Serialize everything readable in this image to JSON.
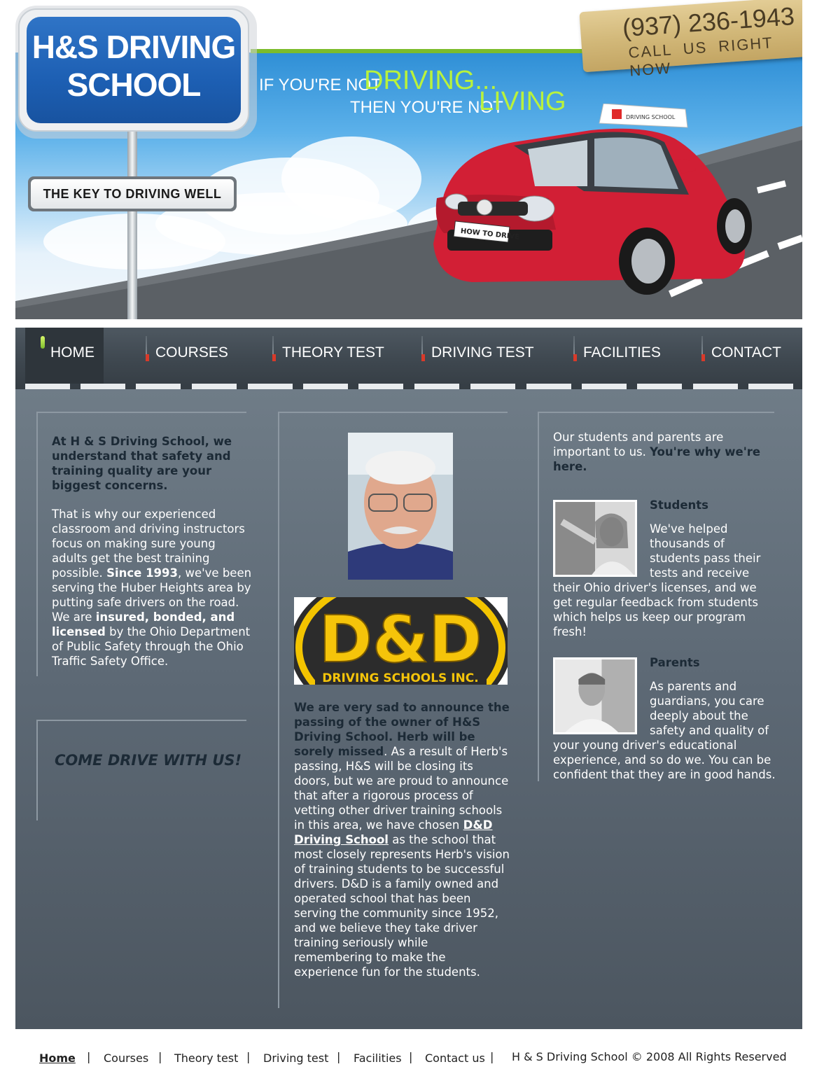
{
  "header": {
    "logo_line1": "H&S DRIVING",
    "logo_line2": "SCHOOL",
    "key_sign": "THE  KEY  TO  DRIVING WELL",
    "slogan_part1": "IF YOU'RE NOT",
    "slogan_part2": "DRIVING...",
    "slogan_part3": "THEN YOU'RE NOT",
    "slogan_part4": "LIVING",
    "phone": "(937) 236-1943",
    "call_now": "CALL US RIGHT NOW",
    "car_plate": "HOW TO DRIVE",
    "roof_sign": "DRIVING SCHOOL",
    "colors": {
      "sign_blue": "#1d5fb3",
      "accent_green": "#b9f23c",
      "line_green": "#7cbc2c"
    }
  },
  "nav": {
    "items": [
      {
        "label": "HOME",
        "active": true
      },
      {
        "label": "COURSES",
        "active": false
      },
      {
        "label": "THEORY TEST",
        "active": false
      },
      {
        "label": "DRIVING TEST",
        "active": false
      },
      {
        "label": "FACILITIES",
        "active": false
      },
      {
        "label": "CONTACT US",
        "active": false
      }
    ]
  },
  "left": {
    "intro": "At H & S Driving School, we understand that safety and training quality are your biggest concerns.",
    "body_1": "That is why our experienced classroom and driving instructors focus on making sure young adults get the best training possible.",
    "body_since": "Since 1993",
    "body_2": ", we've been serving the Huber Heights area by putting safe drivers on the road. We are",
    "body_insured": "insured, bonded, and licensed",
    "body_3": " by the Ohio Department of Public Safety through the Ohio Traffic Safety Office.",
    "cta": "COME DRIVE WITH US!"
  },
  "middle": {
    "logo_text_big": "D&D",
    "logo_text_small": "DRIVING SCHOOLS INC.",
    "announce_bold": "We are very sad to announce the passing of the owner of H&S Driving School. Herb will be sorely missed",
    "announce_1": ". As a result of Herb's passing, H&S will be closing its doors, but we are proud to announce that after a rigorous process of vetting other driver training schools in this area, we have chosen ",
    "link_text": "D&D Driving School",
    "announce_2": " as the school that most closely represents Herb's vision of training students to be successful drivers. D&D is a family owned and operated school that has been serving the community since 1952, and we believe they take driver training seriously while remembering to make the experience fun for the students."
  },
  "right": {
    "intro_plain": "Our students and parents are important to us. ",
    "intro_bold": "You're why we're here.",
    "students_title": "Students",
    "students_text": "We've helped thousands of students pass their tests and receive their Ohio driver's licenses, and we get regular feedback from students which helps us keep our program fresh!",
    "parents_title": "Parents",
    "parents_text": "As parents and guardians, you care deeply about the safety and quality of your young driver's educational experience, and so do we. You can be confident that they are in good hands."
  },
  "footer": {
    "links": [
      "Home",
      "Courses",
      "Theory test",
      "Driving test",
      "Facilities",
      "Contact us"
    ],
    "separator": "|",
    "copyright": "H & S Driving School © 2008 All Rights Reserved"
  }
}
